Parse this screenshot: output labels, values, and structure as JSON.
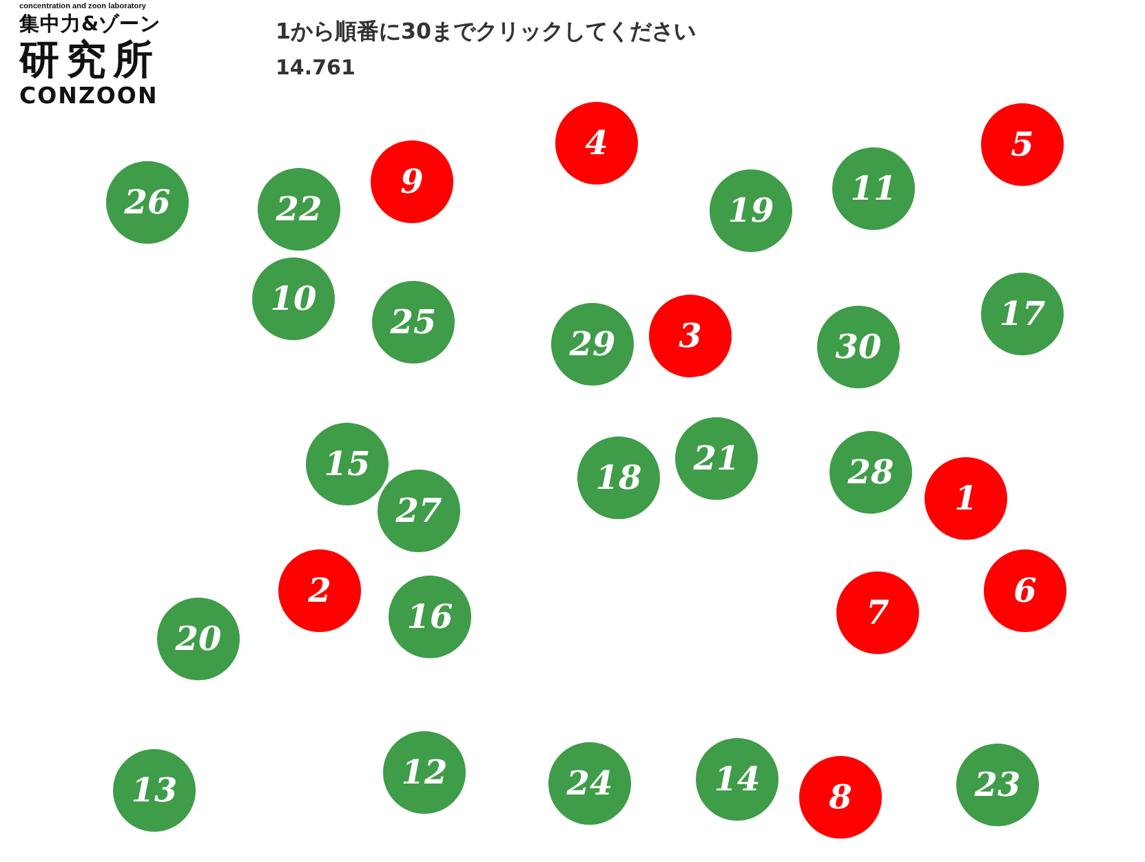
{
  "logo": {
    "tagline": "concentration and zoon laboratory",
    "title": "集中力&ゾーン",
    "subtitle": "研究所",
    "brand": "CONZOON"
  },
  "instruction": "1から順番に30までクリックしてください",
  "timer": "14.761",
  "circles": [
    {
      "label": "26",
      "color": "#3f9c48"
    },
    {
      "label": "22",
      "color": "#3f9c48"
    },
    {
      "label": "9",
      "color": "#ff0000"
    },
    {
      "label": "4",
      "color": "#ff0000"
    },
    {
      "label": "19",
      "color": "#3f9c48"
    },
    {
      "label": "11",
      "color": "#3f9c48"
    },
    {
      "label": "5",
      "color": "#ff0000"
    },
    {
      "label": "10",
      "color": "#3f9c48"
    },
    {
      "label": "25",
      "color": "#3f9c48"
    },
    {
      "label": "29",
      "color": "#3f9c48"
    },
    {
      "label": "3",
      "color": "#ff0000"
    },
    {
      "label": "30",
      "color": "#3f9c48"
    },
    {
      "label": "17",
      "color": "#3f9c48"
    },
    {
      "label": "15",
      "color": "#3f9c48"
    },
    {
      "label": "27",
      "color": "#3f9c48"
    },
    {
      "label": "18",
      "color": "#3f9c48"
    },
    {
      "label": "21",
      "color": "#3f9c48"
    },
    {
      "label": "28",
      "color": "#3f9c48"
    },
    {
      "label": "1",
      "color": "#ff0000"
    },
    {
      "label": "20",
      "color": "#3f9c48"
    },
    {
      "label": "2",
      "color": "#ff0000"
    },
    {
      "label": "16",
      "color": "#3f9c48"
    },
    {
      "label": "7",
      "color": "#ff0000"
    },
    {
      "label": "6",
      "color": "#ff0000"
    },
    {
      "label": "13",
      "color": "#3f9c48"
    },
    {
      "label": "12",
      "color": "#3f9c48"
    },
    {
      "label": "24",
      "color": "#3f9c48"
    },
    {
      "label": "14",
      "color": "#3f9c48"
    },
    {
      "label": "8",
      "color": "#ff0000"
    },
    {
      "label": "23",
      "color": "#3f9c48"
    }
  ]
}
